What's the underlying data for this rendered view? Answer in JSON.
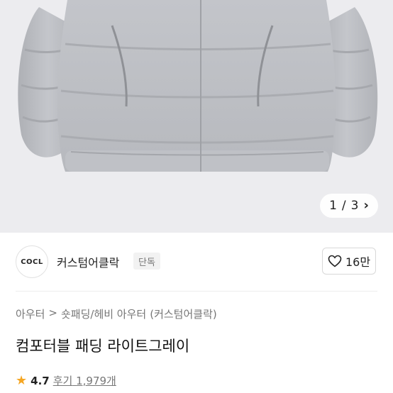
{
  "hero": {
    "image": "gray-padded-jacket-photo",
    "pager": {
      "current": "1",
      "separator": "/",
      "total": "3",
      "next_icon": "chevron-right-icon"
    }
  },
  "brand": {
    "logo_text": "COCL",
    "name": "커스텀어클락",
    "badge": "단독",
    "like": {
      "icon": "heart-icon",
      "count": "16만"
    }
  },
  "breadcrumb": {
    "root": "아우터",
    "separator": ">",
    "category": "숏패딩/헤비 아우터",
    "brand_suffix": "(커스텀어클락)"
  },
  "product": {
    "title": "컴포터블 패딩 라이트그레이",
    "rating": {
      "star_icon": "star-icon",
      "score": "4.7",
      "reviews_label": "후기",
      "reviews_count": "1,979개"
    }
  },
  "colors": {
    "star": "#f5a623",
    "jacket": "#c7c9ce",
    "background": "#ececef"
  }
}
